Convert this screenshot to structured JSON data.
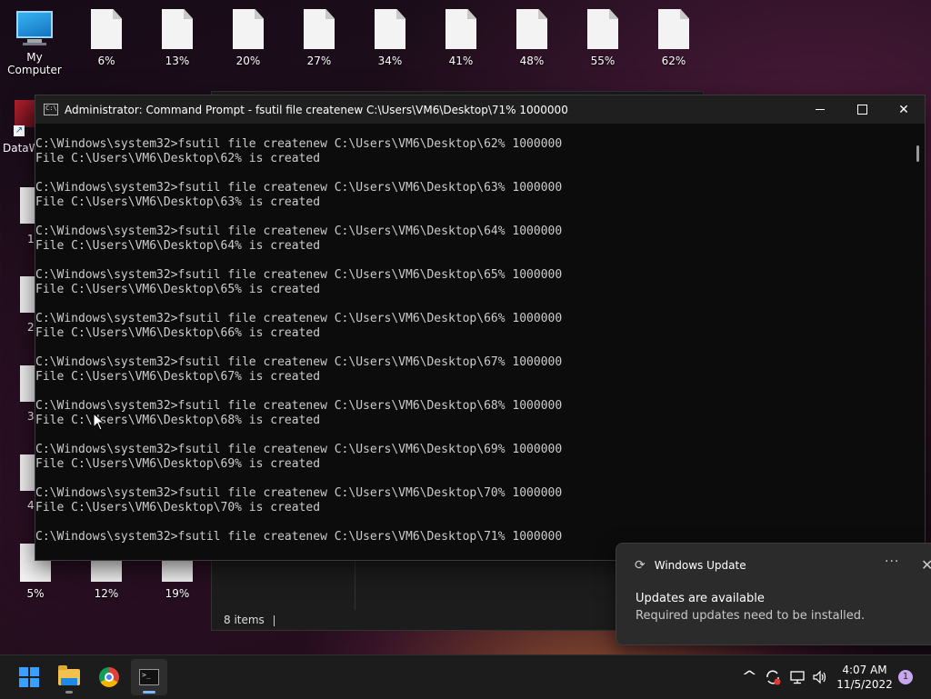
{
  "desktop": {
    "top_icons": [
      {
        "label": "My Computer",
        "icon": "computer-icon"
      },
      {
        "label": "6%",
        "icon": "file-icon"
      },
      {
        "label": "13%",
        "icon": "file-icon"
      },
      {
        "label": "20%",
        "icon": "file-icon"
      },
      {
        "label": "27%",
        "icon": "file-icon"
      },
      {
        "label": "34%",
        "icon": "file-icon"
      },
      {
        "label": "41%",
        "icon": "file-icon"
      },
      {
        "label": "48%",
        "icon": "file-icon"
      },
      {
        "label": "55%",
        "icon": "file-icon"
      },
      {
        "label": "62%",
        "icon": "file-icon"
      }
    ],
    "bottom_icons": [
      "5%",
      "12%",
      "19%"
    ],
    "partial_label": "DataW",
    "left_partial_numbers": [
      "1",
      "2",
      "3",
      "4"
    ]
  },
  "explorer": {
    "status_items": "8 items"
  },
  "cmd": {
    "title": "Administrator: Command Prompt - fsutil  file createnew C:\\Users\\VM6\\Desktop\\71% 1000000",
    "icon_text": "C:\\",
    "lines": [
      "C:\\Windows\\system32>fsutil file createnew C:\\Users\\VM6\\Desktop\\62% 1000000",
      "File C:\\Users\\VM6\\Desktop\\62% is created",
      "",
      "C:\\Windows\\system32>fsutil file createnew C:\\Users\\VM6\\Desktop\\63% 1000000",
      "File C:\\Users\\VM6\\Desktop\\63% is created",
      "",
      "C:\\Windows\\system32>fsutil file createnew C:\\Users\\VM6\\Desktop\\64% 1000000",
      "File C:\\Users\\VM6\\Desktop\\64% is created",
      "",
      "C:\\Windows\\system32>fsutil file createnew C:\\Users\\VM6\\Desktop\\65% 1000000",
      "File C:\\Users\\VM6\\Desktop\\65% is created",
      "",
      "C:\\Windows\\system32>fsutil file createnew C:\\Users\\VM6\\Desktop\\66% 1000000",
      "File C:\\Users\\VM6\\Desktop\\66% is created",
      "",
      "C:\\Windows\\system32>fsutil file createnew C:\\Users\\VM6\\Desktop\\67% 1000000",
      "File C:\\Users\\VM6\\Desktop\\67% is created",
      "",
      "C:\\Windows\\system32>fsutil file createnew C:\\Users\\VM6\\Desktop\\68% 1000000",
      "File C:\\Users\\VM6\\Desktop\\68% is created",
      "",
      "C:\\Windows\\system32>fsutil file createnew C:\\Users\\VM6\\Desktop\\69% 1000000",
      "File C:\\Users\\VM6\\Desktop\\69% is created",
      "",
      "C:\\Windows\\system32>fsutil file createnew C:\\Users\\VM6\\Desktop\\70% 1000000",
      "File C:\\Users\\VM6\\Desktop\\70% is created",
      "",
      "C:\\Windows\\system32>fsutil file createnew C:\\Users\\VM6\\Desktop\\71% 1000000"
    ]
  },
  "notification": {
    "app": "Windows Update",
    "more": "···",
    "close": "✕",
    "heading": "Updates are available",
    "body": "Required updates need to be installed."
  },
  "taskbar": {
    "time": "4:07 AM",
    "date": "11/5/2022",
    "notification_count": "1",
    "tray_chevron": "^"
  },
  "colors": {
    "console_bg": "#0c0c0c",
    "console_text": "#cccccc",
    "accent": "#3aa0ff"
  }
}
